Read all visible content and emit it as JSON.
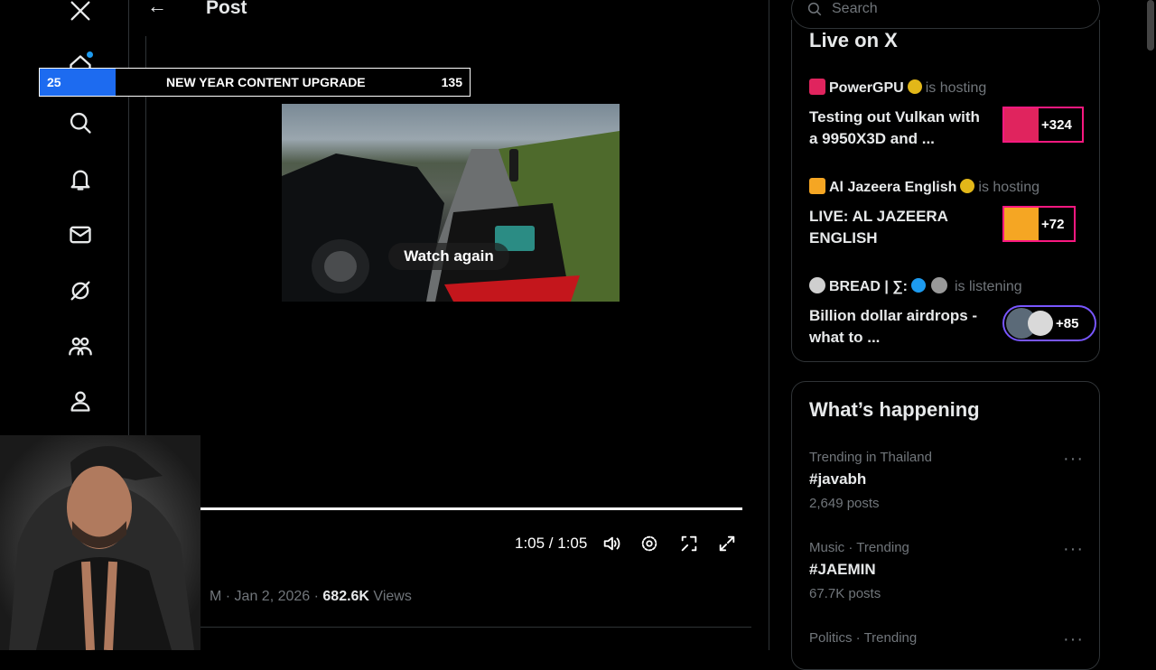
{
  "header": {
    "back_label": "←",
    "title": "Post"
  },
  "overlay": {
    "left_value": "25",
    "label": "NEW YEAR CONTENT UPGRADE",
    "right_value": "135",
    "progress_fraction": 0.18
  },
  "video": {
    "watch_again": "Watch again",
    "time": "1:05 / 1:05",
    "progress_fraction": 1.0
  },
  "post_meta": {
    "prefix": "M · Jan 2, 2026 · ",
    "views_count": "682.6K",
    "views_label": " Views"
  },
  "search": {
    "placeholder": "Search"
  },
  "live": {
    "title": "Live on X",
    "items": [
      {
        "host": "PowerGPU",
        "status": "is hosting",
        "title": "Testing out Vulkan with a 9950X3D and ...",
        "count": "+324"
      },
      {
        "host": "Al Jazeera English",
        "status": "is hosting",
        "title": "LIVE: AL JAZEERA ENGLISH",
        "count": "+72"
      },
      {
        "host": "BREAD | ∑:",
        "status": "is listening",
        "title": "Billion dollar airdrops - what to ...",
        "count": "+85"
      }
    ]
  },
  "happening": {
    "title": "What’s happening",
    "trends": [
      {
        "category": "Trending in Thailand",
        "name": "#javabh",
        "count": "2,649 posts"
      },
      {
        "category": "Music · Trending",
        "name": "#JAEMIN",
        "count": "67.7K posts"
      },
      {
        "category": "Politics · Trending",
        "name": "",
        "count": ""
      }
    ],
    "more": "···"
  },
  "colors": {
    "accent": "#1d9bf0",
    "live_border": "#f91880",
    "listening_border": "#7856ff",
    "bg": "#000000"
  }
}
